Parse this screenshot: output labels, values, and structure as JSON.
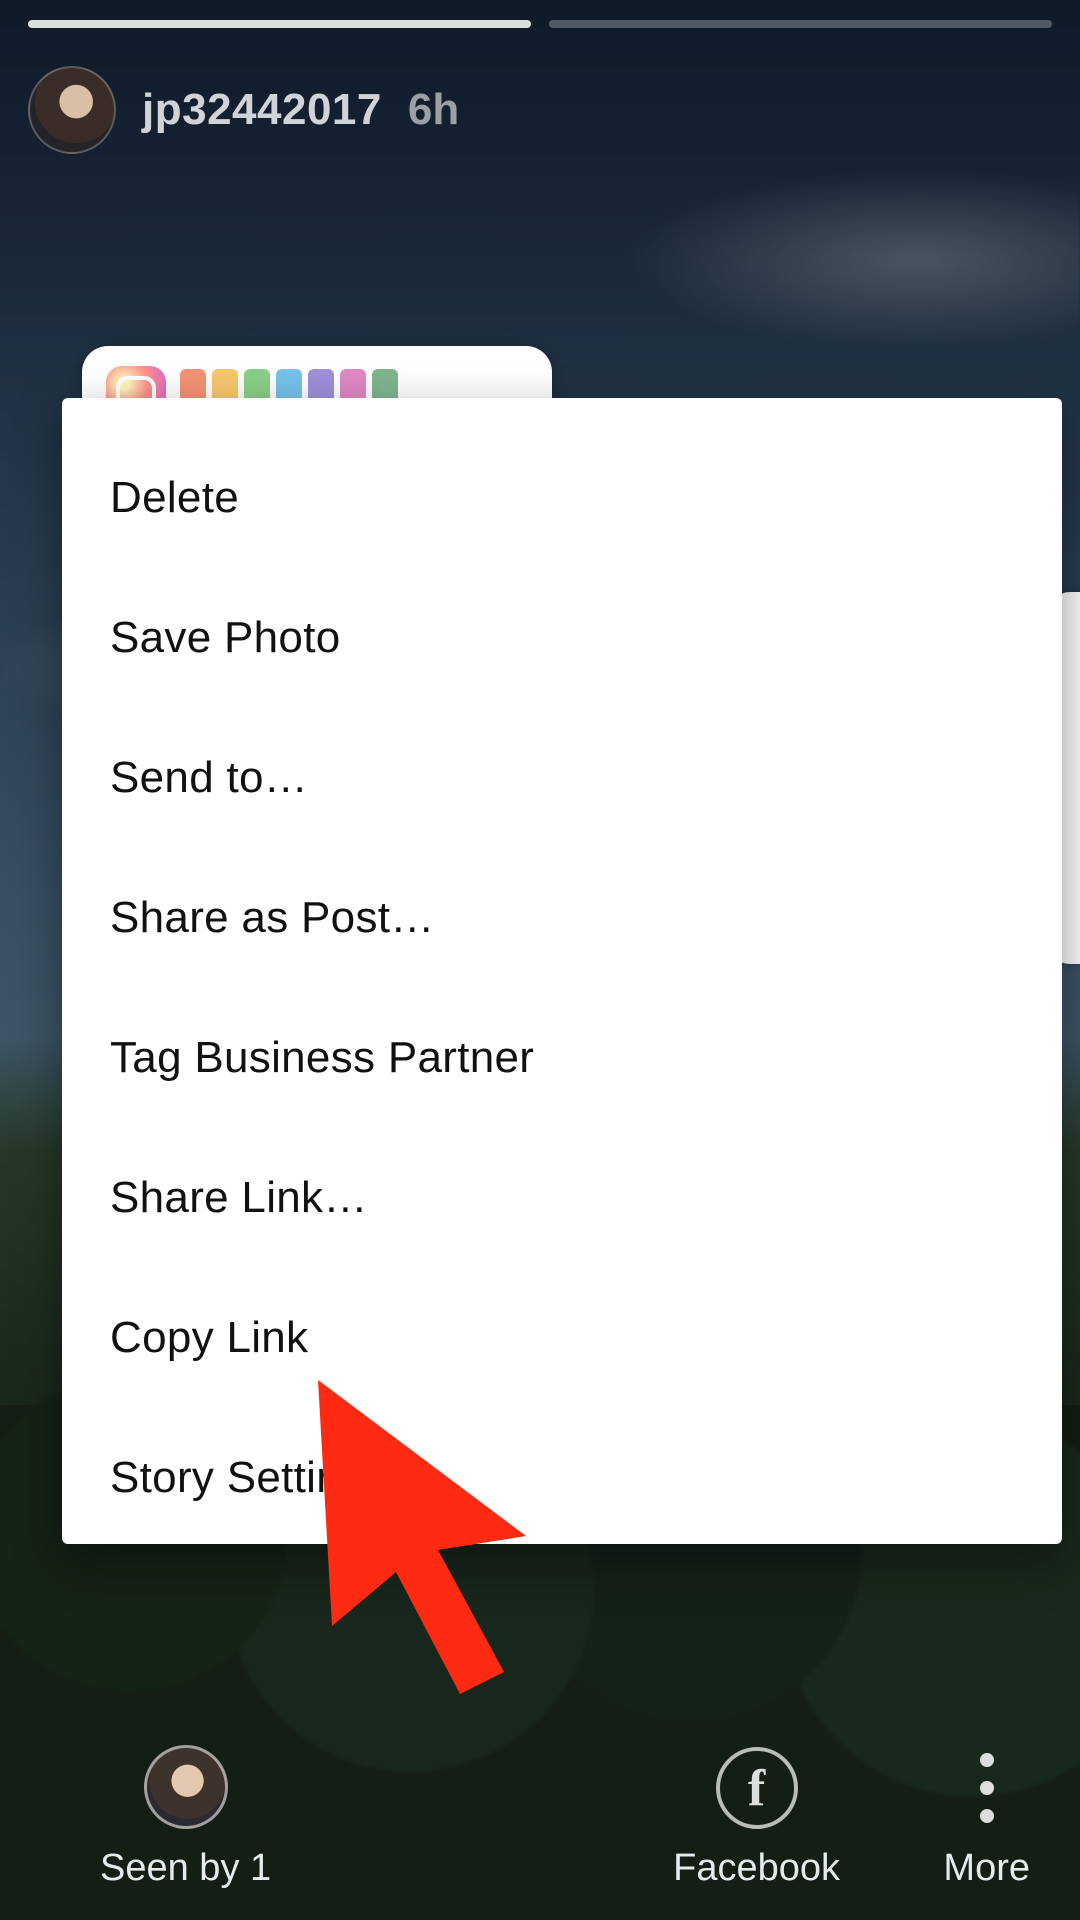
{
  "story": {
    "username": "jp32442017",
    "timestamp": "6h",
    "progress_segments": 2,
    "progress_filled_upto": 1
  },
  "sticker": {
    "letter_colors": [
      "#f05a2a",
      "#f4aa20",
      "#4cb648",
      "#2aa3e0",
      "#6b55c7",
      "#d24aa6",
      "#3a8f52"
    ]
  },
  "menu": {
    "items": [
      {
        "label": "Delete"
      },
      {
        "label": "Save Photo"
      },
      {
        "label": "Send to…"
      },
      {
        "label": "Share as Post…"
      },
      {
        "label": "Tag Business Partner"
      },
      {
        "label": "Share Link…"
      },
      {
        "label": "Copy Link"
      },
      {
        "label": "Story Settings"
      }
    ]
  },
  "bottom": {
    "seen_label": "Seen by 1",
    "facebook_label": "Facebook",
    "facebook_icon_glyph": "f",
    "more_label": "More"
  },
  "annotation": {
    "arrow_color": "#ff2a12"
  }
}
